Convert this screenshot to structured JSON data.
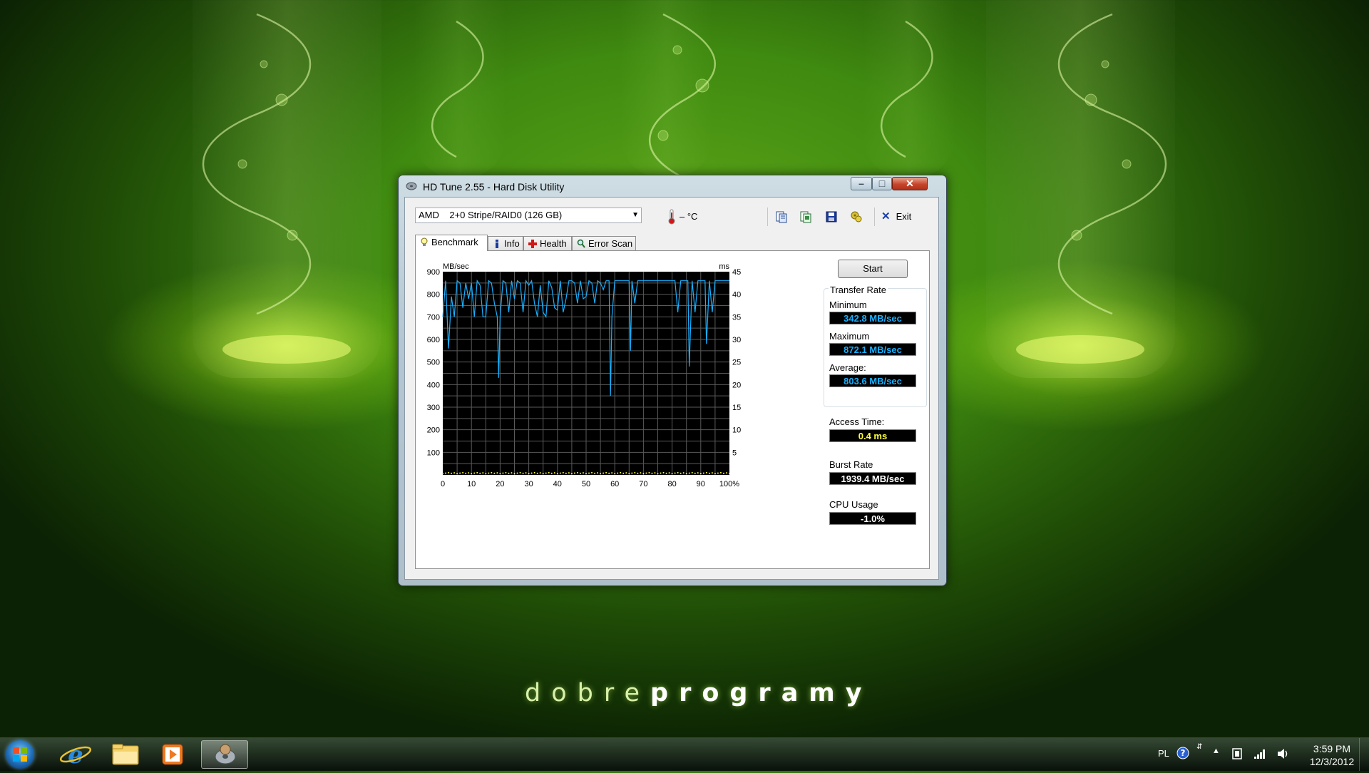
{
  "wallpaper": {
    "brand_light": "dobre",
    "brand_bold": "programy"
  },
  "window": {
    "title": "HD Tune 2.55 - Hard Disk Utility",
    "close_glyph": "✕",
    "min_glyph": "–",
    "max_glyph": "□"
  },
  "toolbar": {
    "drive": "AMD    2+0 Stripe/RAID0 (126 GB)",
    "temperature": "– °C",
    "exit_label": "Exit",
    "icons": [
      "copy-text-icon",
      "copy-screen-icon",
      "save-icon",
      "options-icon"
    ]
  },
  "tabs": [
    "Benchmark",
    "Info",
    "Health",
    "Error Scan"
  ],
  "benchmark": {
    "start_label": "Start",
    "transfer_rate_label": "Transfer Rate",
    "minimum_label": "Minimum",
    "minimum_value": "342.8 MB/sec",
    "maximum_label": "Maximum",
    "maximum_value": "872.1 MB/sec",
    "average_label": "Average:",
    "average_value": "803.6 MB/sec",
    "access_time_label": "Access Time:",
    "access_time_value": "0.4 ms",
    "burst_rate_label": "Burst Rate",
    "burst_rate_value": "1939.4 MB/sec",
    "cpu_usage_label": "CPU Usage",
    "cpu_usage_value": "-1.0%",
    "colors": {
      "rate_line": "#19b0ff",
      "access_dots": "#ffff3c",
      "plot_bg": "#000000",
      "grid": "#5a5a5a"
    }
  },
  "chart_data": {
    "type": "line",
    "ylabel_left": "MB/sec",
    "ylabel_right": "ms",
    "xlim": [
      0,
      100
    ],
    "ylim_left": [
      0,
      900
    ],
    "ylim_right": [
      0,
      45
    ],
    "x_ticks": [
      "0",
      "10",
      "20",
      "30",
      "40",
      "50",
      "60",
      "70",
      "80",
      "90",
      "100%"
    ],
    "y_ticks_left": [
      "100",
      "200",
      "300",
      "400",
      "500",
      "600",
      "700",
      "800",
      "900"
    ],
    "y_ticks_right": [
      "5",
      "10",
      "15",
      "20",
      "25",
      "30",
      "35",
      "40",
      "45"
    ],
    "grid": true,
    "series": [
      {
        "values_kind": "transfer rate (MB/sec)",
        "x": [
          0,
          1,
          2,
          3,
          4,
          5,
          6,
          7,
          8,
          9,
          10,
          11,
          12,
          13,
          14,
          15,
          16,
          17,
          18,
          19,
          19.5,
          20,
          21,
          22,
          23,
          24,
          25,
          26,
          27,
          28,
          29,
          30,
          31,
          32,
          33,
          34,
          35,
          36,
          37,
          38,
          39,
          40,
          41,
          42,
          43,
          44,
          45,
          46,
          47,
          48,
          49,
          50,
          51,
          52,
          53,
          54,
          55,
          56,
          57,
          58,
          58.5,
          59,
          60,
          61,
          62,
          63,
          64,
          65,
          65.5,
          66,
          67,
          68,
          69,
          70,
          71,
          72,
          73,
          74,
          75,
          76,
          77,
          78,
          79,
          80,
          81,
          82,
          83,
          84,
          85,
          85.5,
          86,
          87,
          88,
          89,
          90,
          91,
          91.5,
          92,
          93,
          94,
          95,
          96,
          97,
          98,
          99,
          100
        ],
        "y": [
          700,
          860,
          560,
          790,
          700,
          860,
          850,
          740,
          850,
          780,
          850,
          700,
          860,
          840,
          700,
          700,
          860,
          850,
          760,
          700,
          430,
          700,
          860,
          850,
          720,
          860,
          780,
          860,
          850,
          720,
          860,
          840,
          860,
          760,
          700,
          840,
          720,
          700,
          860,
          830,
          740,
          730,
          860,
          720,
          780,
          860,
          860,
          850,
          760,
          860,
          780,
          790,
          860,
          850,
          760,
          860,
          850,
          820,
          860,
          860,
          350,
          700,
          860,
          860,
          860,
          860,
          860,
          860,
          550,
          860,
          760,
          860,
          860,
          860,
          860,
          860,
          860,
          860,
          860,
          860,
          860,
          860,
          860,
          860,
          860,
          720,
          860,
          860,
          860,
          860,
          480,
          860,
          720,
          860,
          860,
          860,
          860,
          580,
          860,
          720,
          860,
          860,
          860,
          860,
          860,
          860
        ]
      },
      {
        "values_kind": "access time (ms)",
        "x": [
          0,
          100
        ],
        "y": [
          0.4,
          0.4
        ]
      }
    ]
  }
}
